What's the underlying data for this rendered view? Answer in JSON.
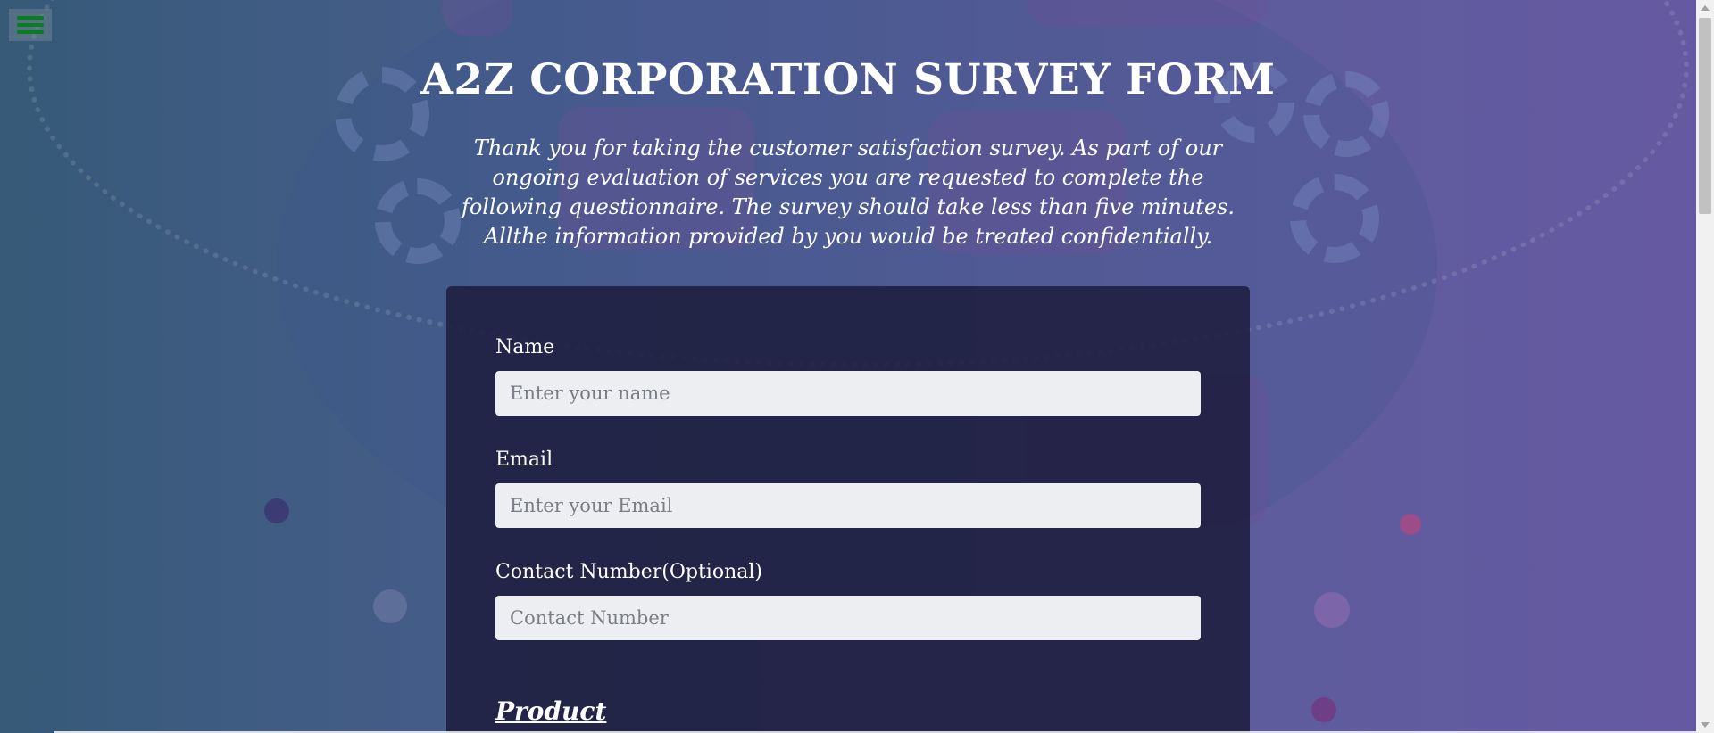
{
  "header": {
    "title": "A2Z CORPORATION SURVEY FORM",
    "description": "Thank you for taking the customer satisfaction survey. As part of our ongoing evaluation of services you are requested to complete the following questionnaire. The survey should take less than five minutes. Allthe information provided by you would be treated confidentially."
  },
  "nav": {
    "menu_icon": "hamburger-menu-icon",
    "menu_icon_color": "#0a7d1f"
  },
  "form": {
    "fields": [
      {
        "label": "Name",
        "placeholder": "Enter your name",
        "value": ""
      },
      {
        "label": "Email",
        "placeholder": "Enter your Email",
        "value": ""
      },
      {
        "label": "Contact Number(Optional)",
        "placeholder": "Contact Number",
        "value": ""
      }
    ],
    "section_heading": "Product"
  },
  "colors": {
    "background_start": "#365a78",
    "background_end": "#6659a3",
    "card": "#1e1e3e",
    "input_bg": "#eceef1"
  }
}
